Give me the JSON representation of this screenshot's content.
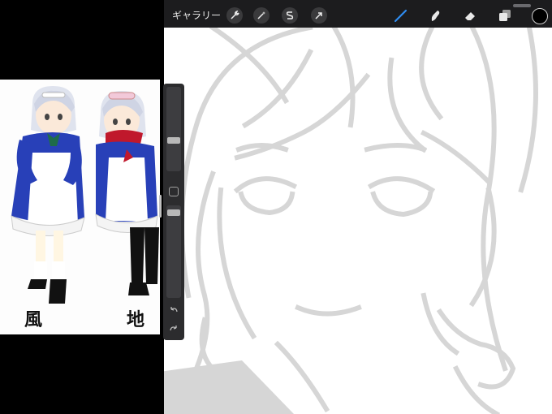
{
  "toolbar": {
    "gallery_label": "ギャラリー",
    "tools": [
      {
        "name": "actions-wrench-icon",
        "interactable": true
      },
      {
        "name": "adjustments-wand-icon",
        "interactable": true
      },
      {
        "name": "selection-s-icon",
        "interactable": true
      },
      {
        "name": "transform-arrow-icon",
        "interactable": true
      }
    ],
    "paint_tools": [
      "brush-icon",
      "smudge-icon",
      "eraser-icon",
      "layers-icon"
    ],
    "active_tool": "brush",
    "accent_color": "#2f8cf0",
    "current_color": "#000000"
  },
  "reference": {
    "captions": [
      "風",
      "地"
    ]
  },
  "sidebar": {
    "brush_size_level": 0.35,
    "opacity_level": 0.95
  },
  "colors": {
    "toolbar_bg": "#1c1c1e",
    "sidebar_bg": "#2c2c2e",
    "sketch_line": "#d6d6d6"
  }
}
